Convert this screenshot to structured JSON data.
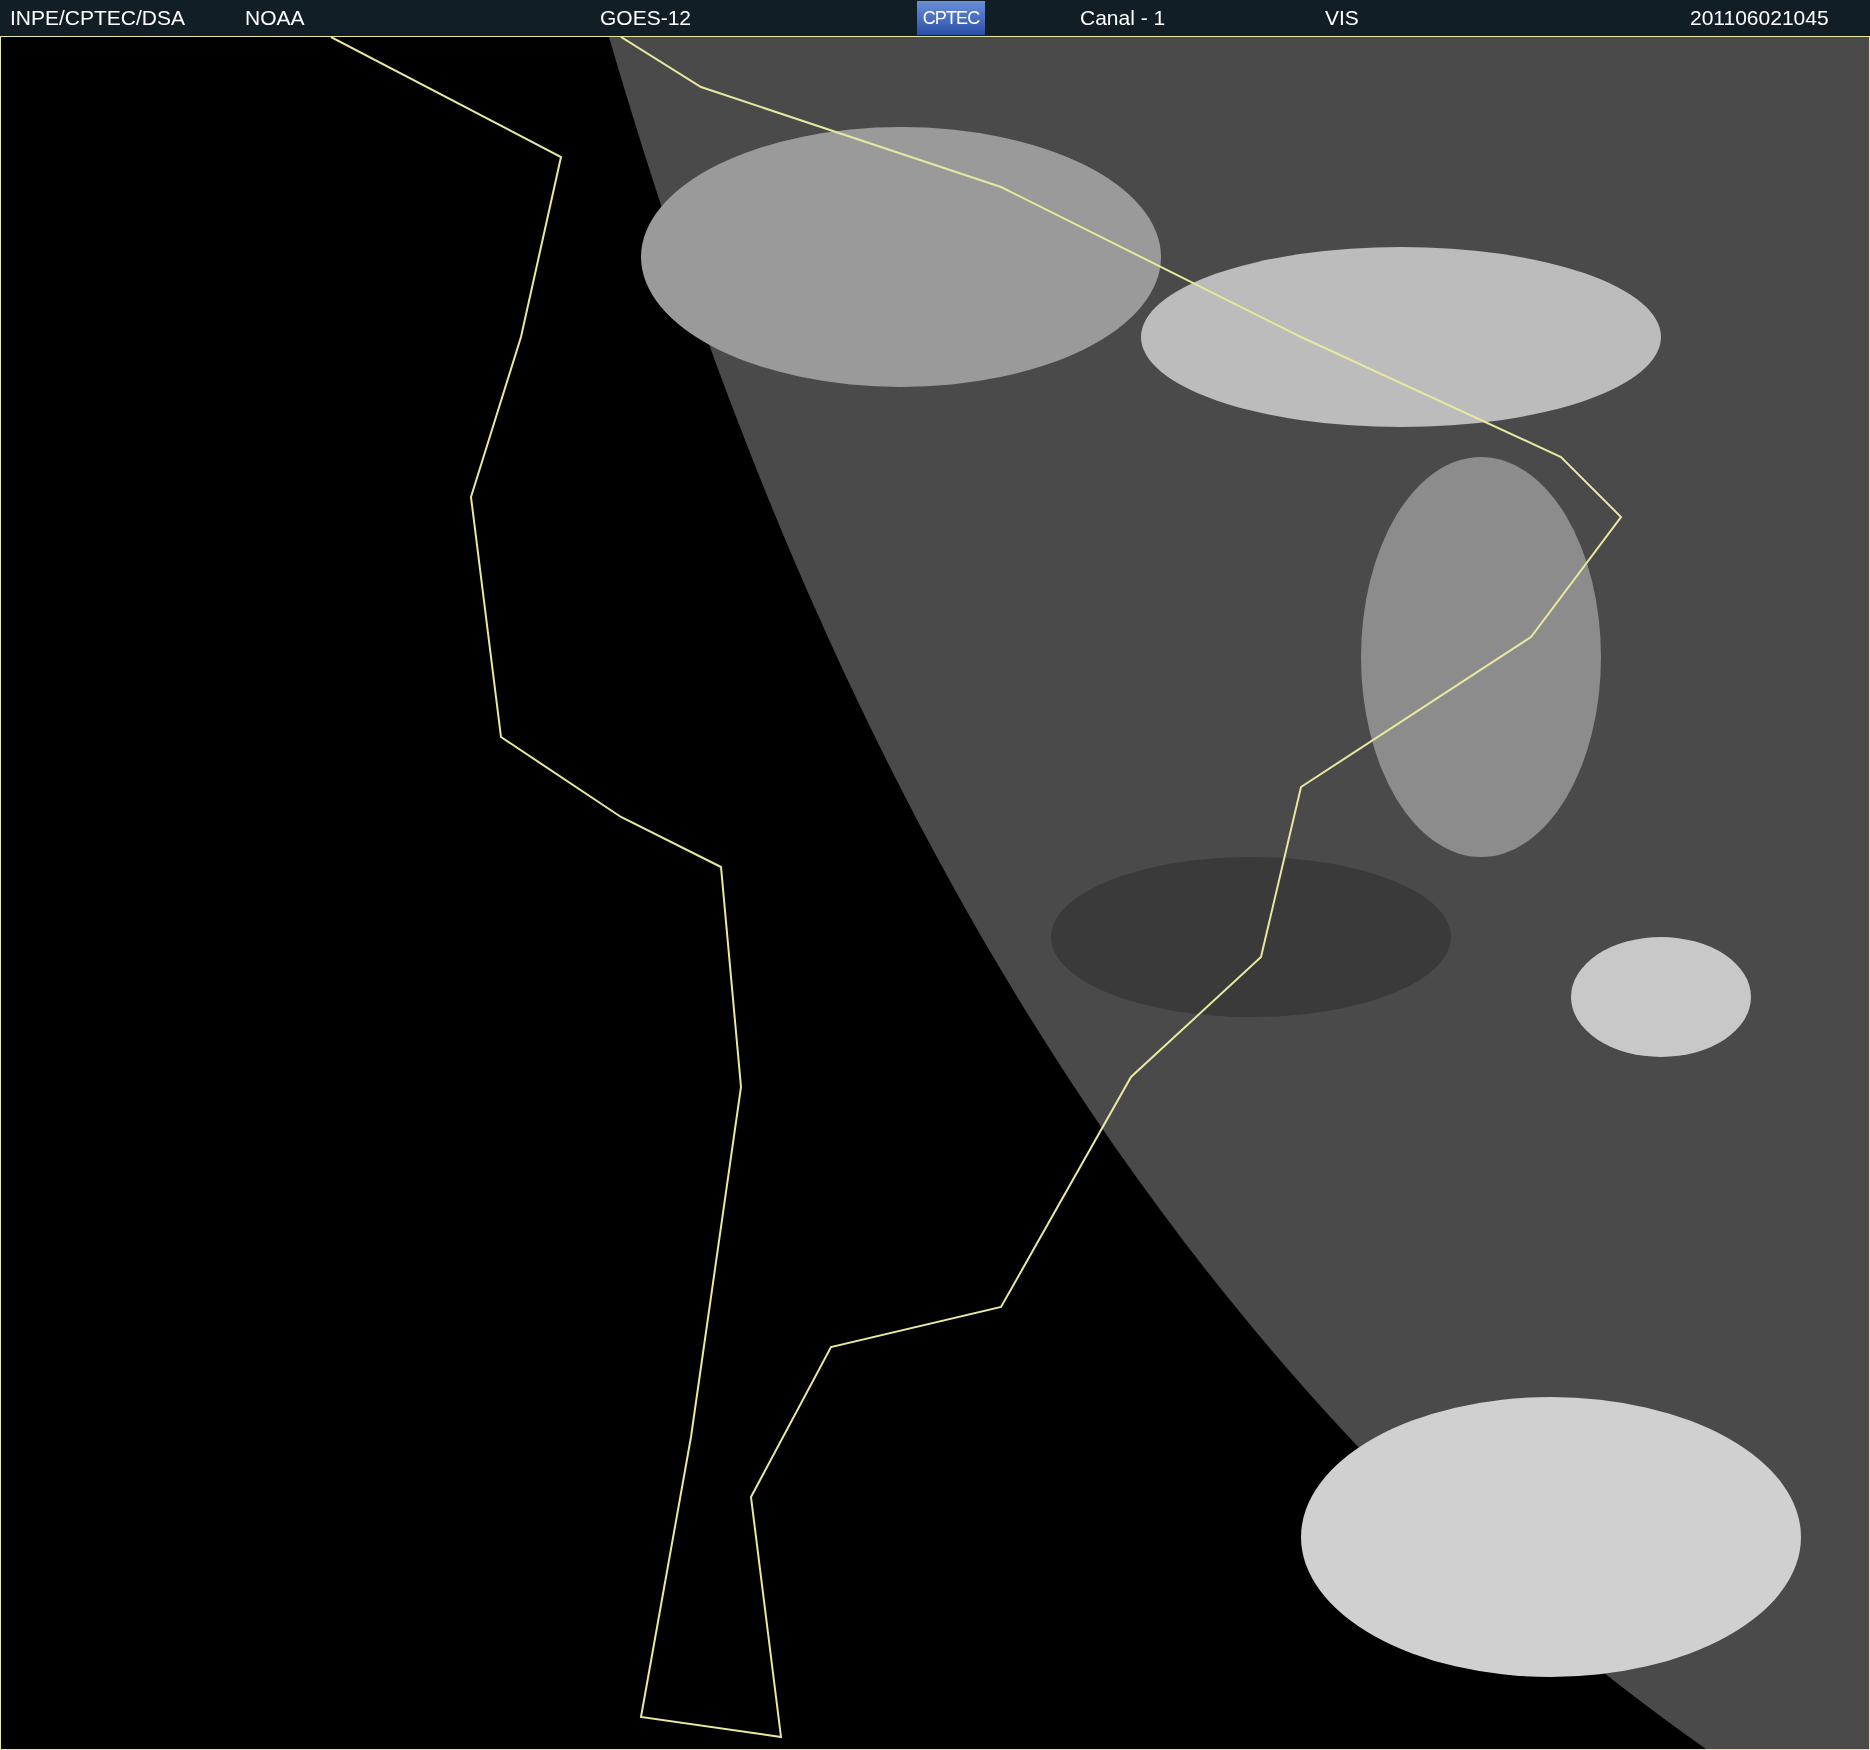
{
  "header": {
    "items": [
      {
        "kind": "text",
        "label": "INPE/CPTEC/DSA"
      },
      {
        "kind": "text",
        "label": "NOAA"
      },
      {
        "kind": "text",
        "label": "GOES-12"
      },
      {
        "kind": "logo",
        "label": "CPTEC"
      },
      {
        "kind": "text",
        "label": "Canal - 1"
      },
      {
        "kind": "text",
        "label": "VIS"
      },
      {
        "kind": "text",
        "label": "201106021045"
      }
    ]
  }
}
